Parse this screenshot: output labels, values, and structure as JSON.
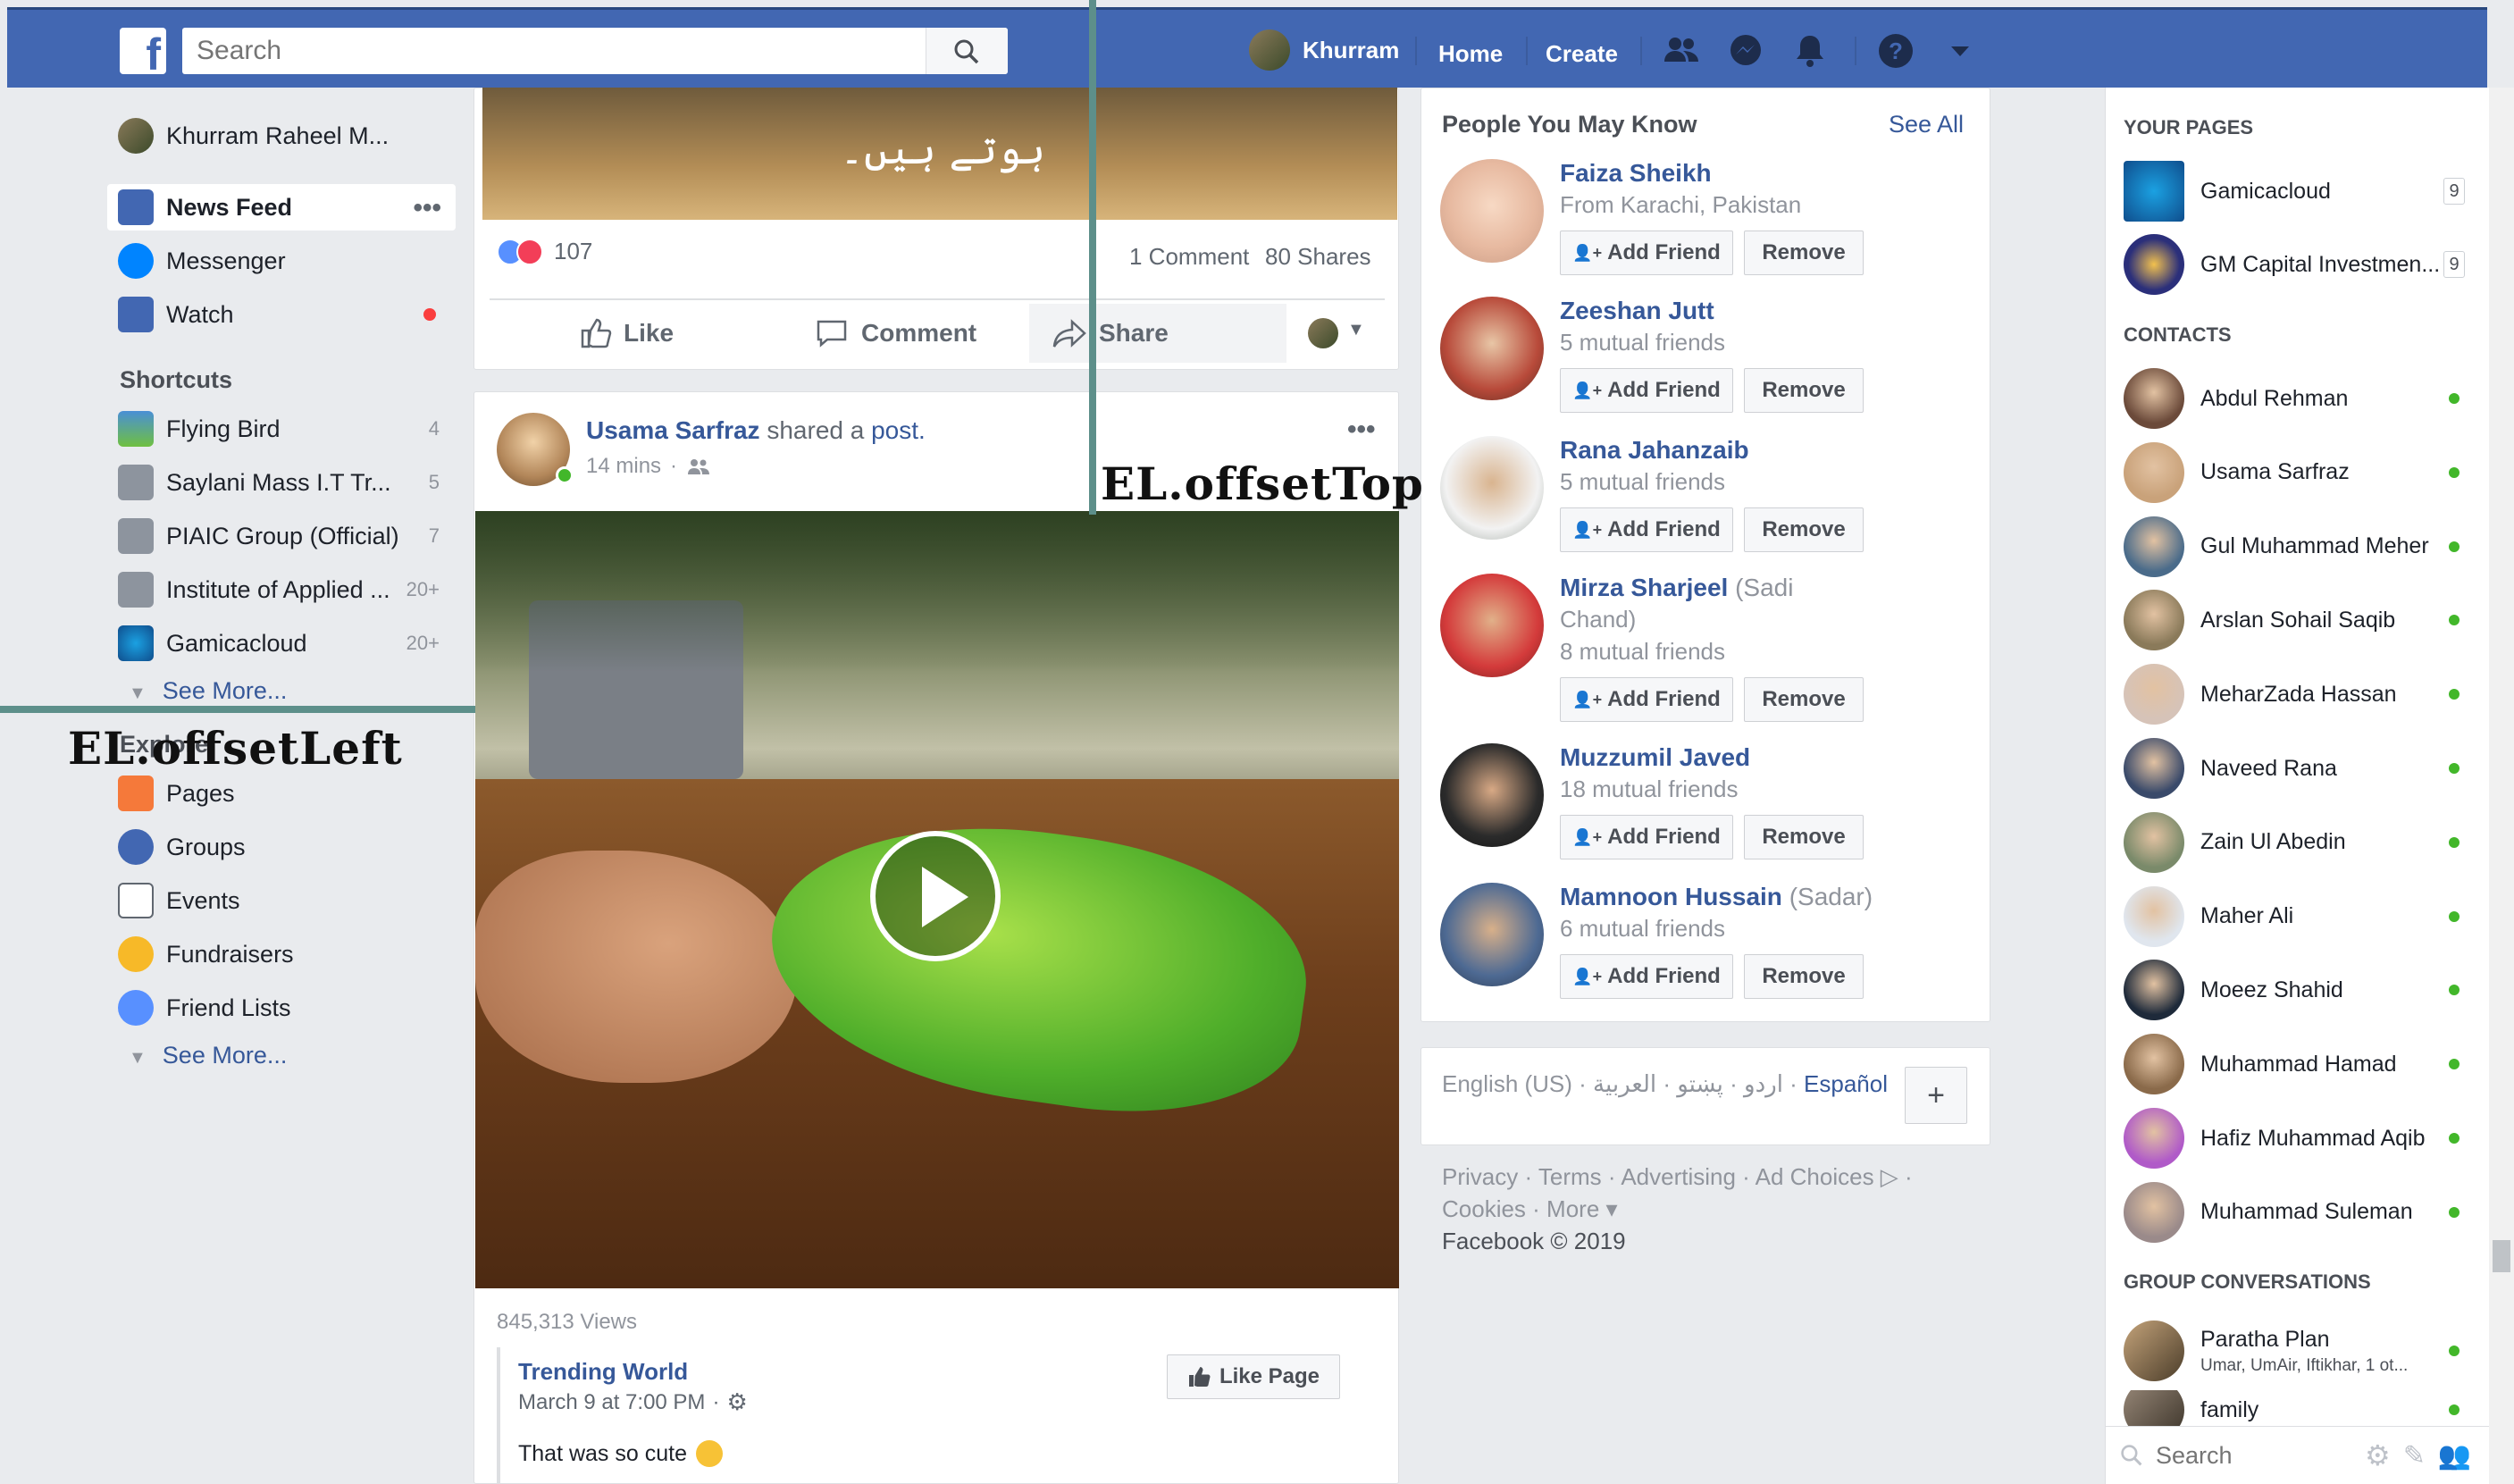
{
  "header": {
    "search_placeholder": "Search",
    "user_name": "Khurram",
    "home": "Home",
    "create": "Create"
  },
  "left_nav": {
    "profile_name": "Khurram Raheel M...",
    "items": [
      {
        "label": "News Feed"
      },
      {
        "label": "Messenger"
      },
      {
        "label": "Watch"
      }
    ],
    "shortcuts_title": "Shortcuts",
    "shortcuts": [
      {
        "label": "Flying Bird",
        "count": "4"
      },
      {
        "label": "Saylani Mass I.T Tr...",
        "count": "5"
      },
      {
        "label": "PIAIC Group (Official)",
        "count": "7"
      },
      {
        "label": "Institute of Applied ...",
        "count": "20+"
      },
      {
        "label": "Gamicacloud",
        "count": "20+"
      }
    ],
    "see_more_1": "See More...",
    "explore_title": "Explore",
    "explore": [
      {
        "label": "Pages"
      },
      {
        "label": "Groups"
      },
      {
        "label": "Events"
      },
      {
        "label": "Fundraisers"
      },
      {
        "label": "Friend Lists"
      }
    ],
    "see_more_2": "See More..."
  },
  "post1": {
    "urdu_text": "ہوتے ہیں۔",
    "reaction_count": "107",
    "comments": "1 Comment",
    "shares": "80 Shares",
    "like": "Like",
    "comment": "Comment",
    "share": "Share"
  },
  "post2": {
    "author": "Usama Sarfraz",
    "action_prefix": "shared a",
    "action_link": "post.",
    "time": "14 mins",
    "views": "845,313 Views",
    "page_name": "Trending World",
    "page_time": "March 9 at 7:00 PM",
    "like_page": "Like Page",
    "caption": "That was so cute"
  },
  "pymk": {
    "title": "People You May Know",
    "see_all": "See All",
    "add_friend": "Add Friend",
    "remove": "Remove",
    "people": [
      {
        "name": "Faiza Sheikh",
        "nick": "",
        "sub1": "From Karachi, Pakistan",
        "sub2": ""
      },
      {
        "name": "Zeeshan Jutt",
        "nick": "",
        "sub1": "5 mutual friends",
        "sub2": ""
      },
      {
        "name": "Rana Jahanzaib",
        "nick": "",
        "sub1": "5 mutual friends",
        "sub2": ""
      },
      {
        "name": "Mirza Sharjeel",
        "nick": "(Sadi",
        "sub1": "Chand)",
        "sub2": "8 mutual friends"
      },
      {
        "name": "Muzzumil Javed",
        "nick": "",
        "sub1": "18 mutual friends",
        "sub2": ""
      },
      {
        "name": "Mamnoon Hussain",
        "nick": "(Sadar)",
        "sub1": "6 mutual friends",
        "sub2": ""
      }
    ]
  },
  "footer": {
    "languages": "English (US) · اردو · پښتو · العربية · ",
    "espanol": "Español",
    "plus": "+",
    "links1": "Privacy · Terms · Advertising · Ad Choices ▷ ·",
    "links2": "Cookies · More ▾",
    "copyright": "Facebook © 2019"
  },
  "right_sidebar": {
    "pages_title": "YOUR PAGES",
    "pages": [
      {
        "name": "Gamicacloud",
        "badge": "9"
      },
      {
        "name": "GM Capital Investmen...",
        "badge": "9"
      }
    ],
    "contacts_title": "CONTACTS",
    "contacts": [
      "Abdul Rehman",
      "Usama Sarfraz",
      "Gul Muhammad Meher",
      "Arslan Sohail Saqib",
      "MeharZada Hassan",
      "Naveed Rana",
      "Zain Ul Abedin",
      "Maher Ali",
      "Moeez Shahid",
      "Muhammad Hamad",
      "Hafiz Muhammad Aqib",
      "Muhammad Suleman"
    ],
    "group_title": "GROUP CONVERSATIONS",
    "groups": [
      {
        "name": "Paratha Plan",
        "members": "Umar, UmAir, Iftikhar, 1 ot..."
      },
      {
        "name": "family",
        "members": ""
      }
    ],
    "search_placeholder": "Search"
  },
  "annotations": {
    "offset_top": "EL.offsetTop",
    "offset_left": "EL.offsetLeft"
  },
  "colors": {
    "brand": "#4267b2",
    "link": "#365899",
    "annotation_line": "#5d8f8a",
    "online": "#42b72a"
  }
}
